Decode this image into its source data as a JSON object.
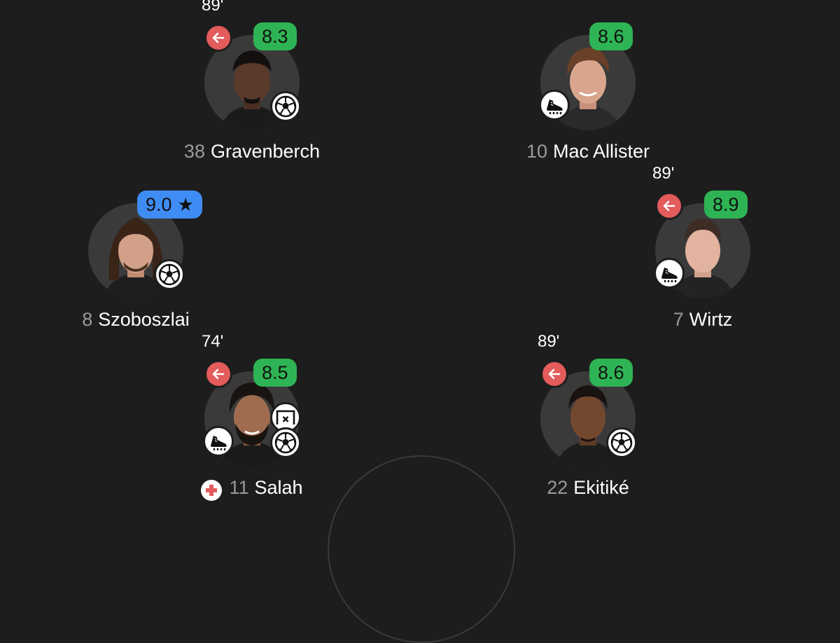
{
  "colors": {
    "background": "#1d1d1d",
    "rating_green": "#2eb454",
    "rating_blue": "#3f8cf5",
    "sub_red": "#e35b5b",
    "avatar_bg": "#3a3a3a"
  },
  "players": {
    "gravenberch": {
      "number": "38",
      "name": "Gravenberch",
      "rating": "8.3",
      "sub_time": "89'",
      "icons": [
        "sub-off-icon",
        "goal-ball-icon"
      ]
    },
    "mac_allister": {
      "number": "10",
      "name": "Mac Allister",
      "rating": "8.6",
      "icons": [
        "assist-boot-icon"
      ]
    },
    "szoboszlai": {
      "number": "8",
      "name": "Szoboszlai",
      "rating": "9.0",
      "player_of_match": true,
      "icons": [
        "star-icon",
        "goal-ball-icon"
      ]
    },
    "wirtz": {
      "number": "7",
      "name": "Wirtz",
      "rating": "8.9",
      "sub_time": "89'",
      "icons": [
        "sub-off-icon",
        "assist-boot-icon"
      ]
    },
    "salah": {
      "number": "11",
      "name": "Salah",
      "rating": "8.5",
      "sub_time": "74'",
      "icons": [
        "sub-off-icon",
        "missed-chance-icon",
        "assist-boot-icon",
        "goal-ball-icon",
        "injury-cross-icon"
      ]
    },
    "ekitike": {
      "number": "22",
      "name": "Ekitiké",
      "rating": "8.6",
      "sub_time": "89'",
      "icons": [
        "sub-off-icon",
        "goal-ball-icon"
      ]
    }
  }
}
